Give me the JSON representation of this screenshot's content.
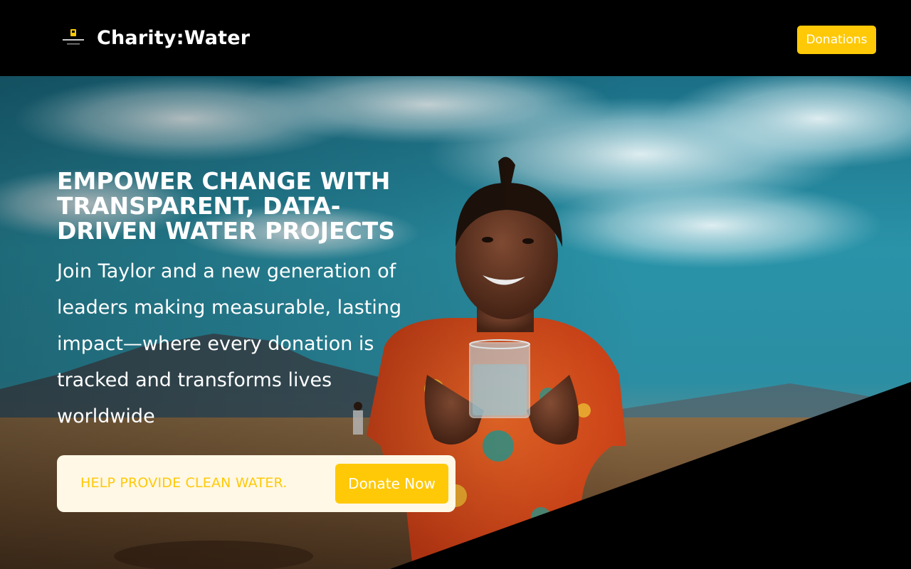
{
  "header": {
    "brand_name": "Charity:Water",
    "donations_label": "Donations"
  },
  "hero": {
    "headline": "EMPOWER CHANGE WITH TRANSPARENT, DATA-DRIVEN WATER PROJECTS",
    "subline": "Join Taylor and a new generation of leaders making measurable, lasting impact—where every donation is tracked and transforms lives worldwide",
    "cta_text": "HELP PROVIDE CLEAN WATER.",
    "donate_label": "Donate Now"
  },
  "colors": {
    "accent": "#ffc907",
    "header_bg": "#000000",
    "card_bg": "#fff8e6",
    "text_light": "#ffffff"
  },
  "icons": {
    "brand_logo": "charity-water-jerrycan-logo-icon"
  }
}
